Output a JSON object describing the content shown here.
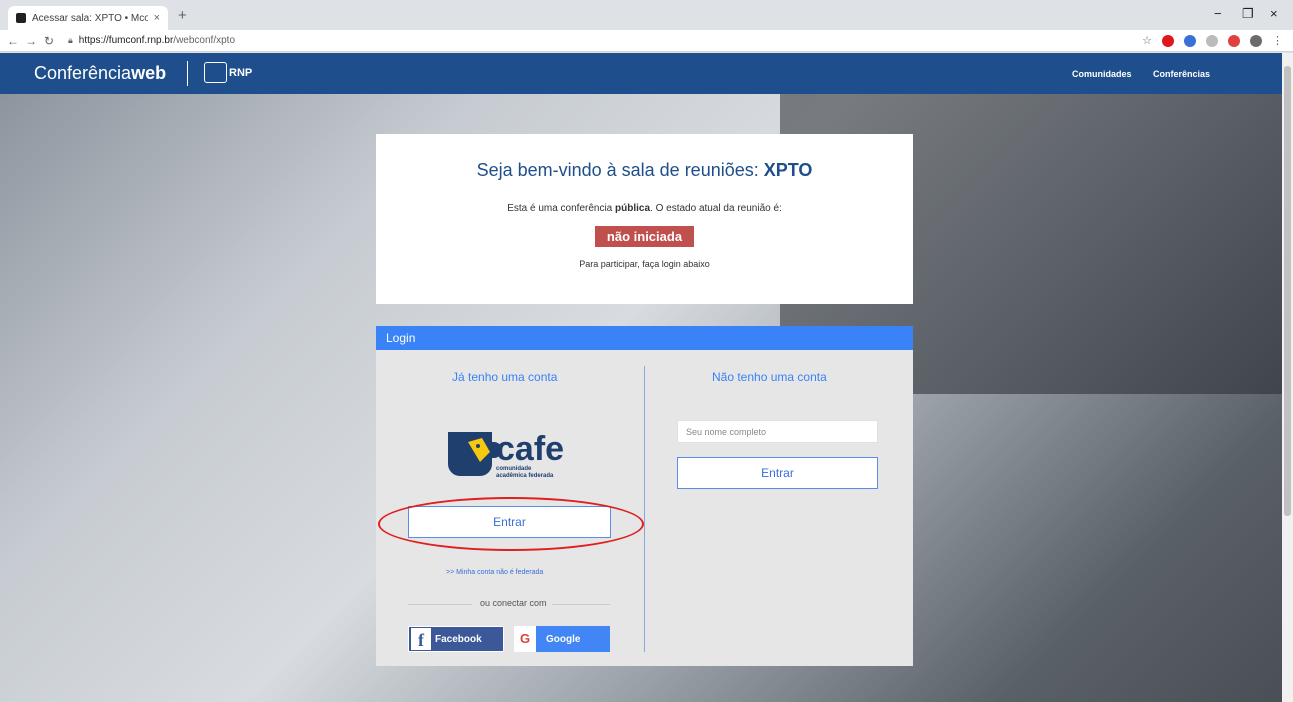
{
  "browser": {
    "tab_title": "Acessar sala: XPTO • Mconf RNP",
    "tab_close": "×",
    "new_tab": "+",
    "url_host": "https://fumconf.rnp.br",
    "url_path": "/webconf/xpto",
    "window_controls": [
      "−",
      "❐",
      "×"
    ]
  },
  "header": {
    "brand_light": "Conferência",
    "brand_bold": "web",
    "partner": "RNP",
    "nav": [
      "Comunidades",
      "Conferências"
    ]
  },
  "welcome": {
    "title_prefix": "Seja bem-vindo à sala de reuniões: ",
    "room_name": "XPTO",
    "desc_prefix": "Esta é uma conferência ",
    "desc_bold": "pública",
    "desc_suffix": ". O estado atual da reunião é:",
    "status": "não iniciada",
    "status_color": "#c0504d",
    "hint": "Para participar, faça login abaixo"
  },
  "login": {
    "header": "Login",
    "left": {
      "title": "Já tenho uma conta",
      "cafe_name": "cafe",
      "cafe_line1": "comunidade",
      "cafe_line2": "acadêmica federada",
      "enter_button": "Entrar",
      "nonfederated_link": ">> Minha conta não é federada",
      "or_connect": "ou conectar com",
      "facebook": "Facebook",
      "google": "Google"
    },
    "right": {
      "title": "Não tenho uma conta",
      "name_placeholder": "Seu nome completo",
      "enter_button": "Entrar"
    }
  },
  "colors": {
    "header_bg": "#1f4e8c",
    "login_header_bg": "#3a82f7",
    "highlight": "#e02020"
  }
}
